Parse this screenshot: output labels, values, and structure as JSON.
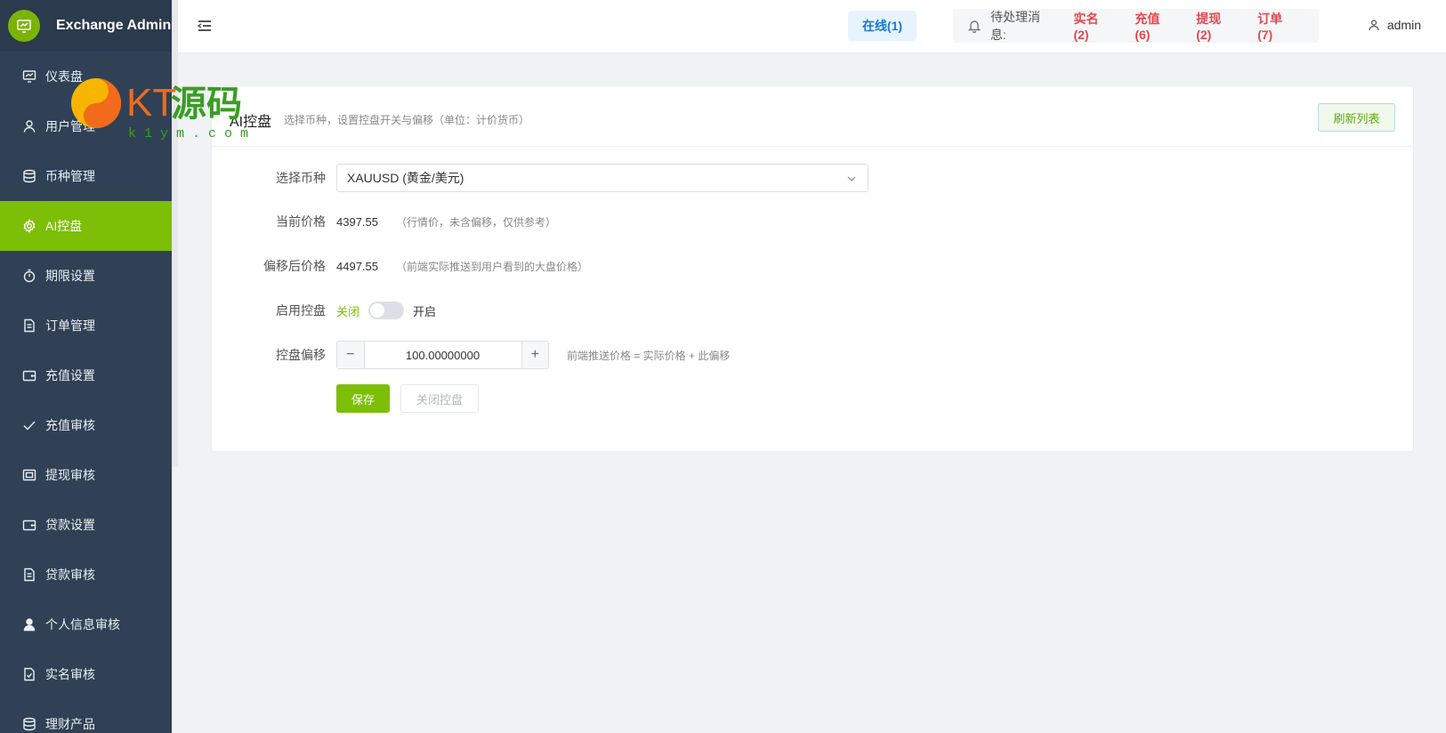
{
  "brand": {
    "title": "Exchange Admin"
  },
  "sidebar": {
    "items": [
      {
        "label": "仪表盘",
        "icon": "chart-board-icon"
      },
      {
        "label": "用户管理",
        "icon": "user-icon"
      },
      {
        "label": "币种管理",
        "icon": "database-icon"
      },
      {
        "label": "AI控盘",
        "icon": "gear-icon",
        "active": true
      },
      {
        "label": "期限设置",
        "icon": "stopwatch-icon"
      },
      {
        "label": "订单管理",
        "icon": "document-icon"
      },
      {
        "label": "充值设置",
        "icon": "wallet-icon"
      },
      {
        "label": "充值审核",
        "icon": "check-icon"
      },
      {
        "label": "提现审核",
        "icon": "money-icon"
      },
      {
        "label": "贷款设置",
        "icon": "wallet-icon"
      },
      {
        "label": "贷款审核",
        "icon": "document-icon"
      },
      {
        "label": "个人信息审核",
        "icon": "person-icon"
      },
      {
        "label": "实名审核",
        "icon": "doc-check-icon"
      },
      {
        "label": "理财产品",
        "icon": "database-icon"
      }
    ]
  },
  "header": {
    "online": "在线(1)",
    "pending_label": "待处理消息:",
    "pending": [
      {
        "label": "实名(2)"
      },
      {
        "label": "充值(6)"
      },
      {
        "label": "提现(2)"
      },
      {
        "label": "订单(7)"
      }
    ],
    "user": "admin"
  },
  "watermark": {
    "text": "KT源码",
    "sub": "k1ym.com"
  },
  "card": {
    "title": "AI控盘",
    "subtitle": "选择币种，设置控盘开关与偏移（单位：计价货币）",
    "refresh_label": "刷新列表"
  },
  "form": {
    "coin_label": "选择币种",
    "coin_value": "XAUUSD (黄金/美元)",
    "price_label": "当前价格",
    "price_value": "4397.55",
    "price_hint": "（行情价，未含偏移，仅供参考）",
    "offset_price_label": "偏移后价格",
    "offset_price_value": "4497.55",
    "offset_price_hint": "（前端实际推送到用户看到的大盘价格）",
    "enable_label": "启用控盘",
    "enable_off": "关闭",
    "enable_on": "开启",
    "offset_label": "控盘偏移",
    "offset_value": "100.00000000",
    "offset_hint": "前端推送价格 = 实际价格 + 此偏移",
    "save_label": "保存",
    "close_label": "关闭控盘"
  },
  "colors": {
    "accent": "#7cbf06",
    "sidebar": "#304156",
    "danger": "#e5484d",
    "online": "#1677d2"
  }
}
